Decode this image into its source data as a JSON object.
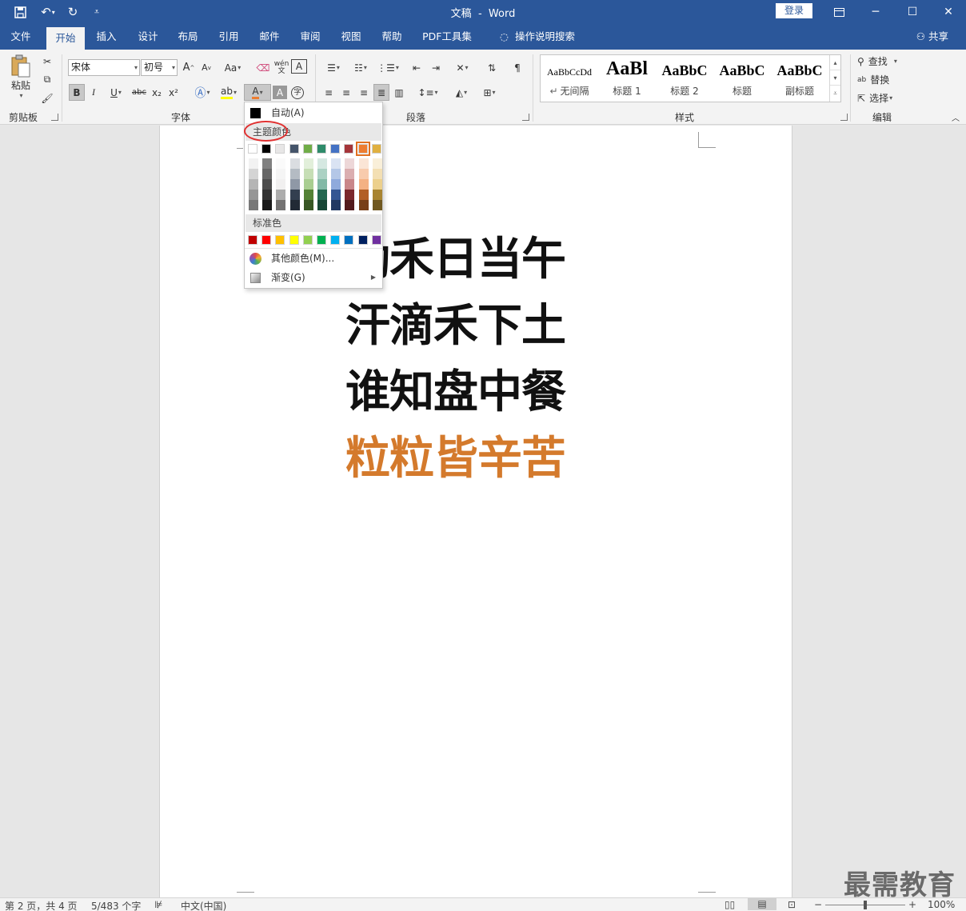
{
  "window": {
    "doc_title": "文稿",
    "separator": "-",
    "app_name": "Word",
    "login_label": "登录",
    "share_label": "共享"
  },
  "tabs": [
    "文件",
    "开始",
    "插入",
    "设计",
    "布局",
    "引用",
    "邮件",
    "审阅",
    "视图",
    "帮助",
    "PDF工具集",
    "操作说明搜索"
  ],
  "active_tab": "开始",
  "ribbon": {
    "clipboard": {
      "paste_label": "粘贴",
      "group_label": "剪贴板"
    },
    "font": {
      "font_name": "宋体",
      "font_size": "初号",
      "group_label": "字体",
      "bold": "B",
      "italic": "I",
      "underline": "U",
      "strike": "abc",
      "sub": "x₂",
      "sup": "x²",
      "font_color_letter": "A",
      "grow": "A",
      "shrink": "A",
      "case": "Aa",
      "phonetic": "wén",
      "enclose": "字"
    },
    "paragraph": {
      "group_label": "段落"
    },
    "styles": {
      "group_label": "样式",
      "items": [
        {
          "sample": "AaBbCcDd",
          "name": "无间隔"
        },
        {
          "sample": "AaBl",
          "name": "标题 1"
        },
        {
          "sample": "AaBbC",
          "name": "标题 2"
        },
        {
          "sample": "AaBbC",
          "name": "标题"
        },
        {
          "sample": "AaBbC",
          "name": "副标题"
        }
      ]
    },
    "editing": {
      "group_label": "编辑",
      "find": "查找",
      "replace": "替换",
      "select": "选择"
    }
  },
  "document": {
    "lines": [
      {
        "text": "锄禾日当午",
        "color": "#111111"
      },
      {
        "text": "汗滴禾下土",
        "color": "#111111"
      },
      {
        "text": "谁知盘中餐",
        "color": "#111111"
      },
      {
        "text": "粒粒皆辛苦",
        "color": "#d47a2c"
      }
    ]
  },
  "color_menu": {
    "auto_label": "自动(A)",
    "theme_header": "主题颜色",
    "standard_header": "标准色",
    "more_colors": "其他颜色(M)...",
    "gradient": "渐变(G)",
    "theme_colors": [
      "#ffffff",
      "#000000",
      "#e7e6e6",
      "#44546a",
      "#70ad47",
      "#2e8b6a",
      "#4472c4",
      "#a5353a",
      "#ed7d31",
      "#e0b040"
    ],
    "standard_colors": [
      "#c00000",
      "#ff0000",
      "#ffc000",
      "#ffff00",
      "#92d050",
      "#00b050",
      "#00b0f0",
      "#0070c0",
      "#002060",
      "#7030a0"
    ],
    "selected_theme_color": "#ed7d31"
  },
  "statusbar": {
    "page": "第 2 页，共 4 页",
    "words": "5/483 个字",
    "language": "中文(中国)",
    "zoom": "100%"
  },
  "watermark": "最需教育"
}
